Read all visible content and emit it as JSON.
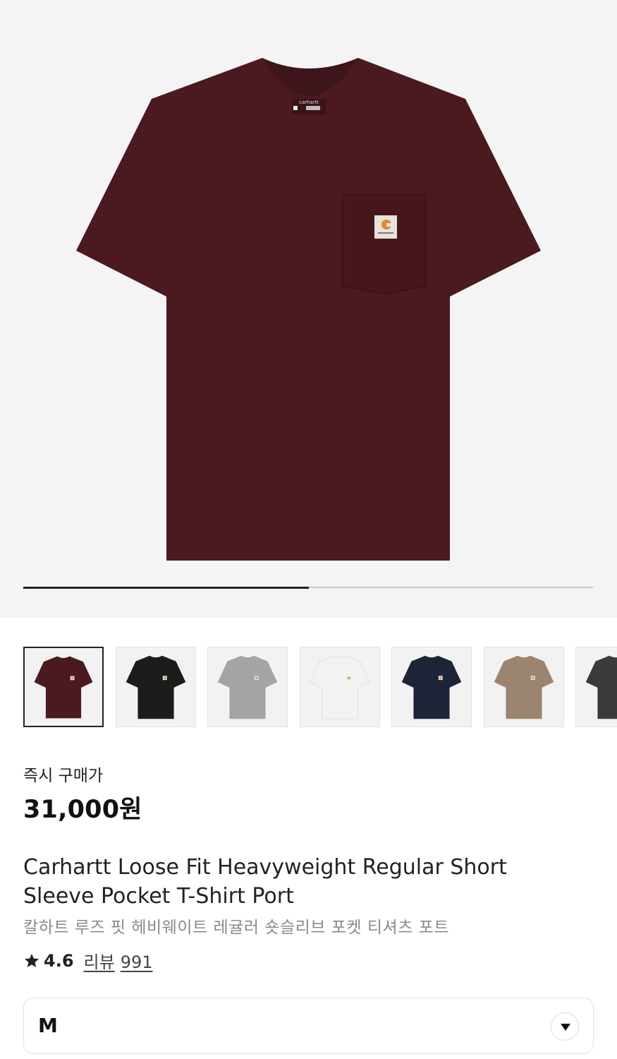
{
  "product": {
    "price_label": "즉시 구매가",
    "price": "31,000원",
    "title": "Carhartt Loose Fit Heavyweight Regular Short Sleeve Pocket T-Shirt Port",
    "subtitle": "칼하트 루즈 핏 헤비웨이트 레귤러 숏슬리브 포켓 티셔츠 포트",
    "rating": "4.6",
    "review_label": "리뷰",
    "review_count": "991",
    "selected_size": "M"
  },
  "gallery": {
    "progress_fraction": 0.5,
    "thumbnails": [
      {
        "color": "#4a1a20",
        "selected": true
      },
      {
        "color": "#1c1c1c",
        "selected": false
      },
      {
        "color": "#a4a4a6",
        "selected": false
      },
      {
        "color": "#f2f2f0",
        "selected": false
      },
      {
        "color": "#1e2437",
        "selected": false
      },
      {
        "color": "#9b8570",
        "selected": false
      },
      {
        "color": "#3a3a3a",
        "selected": false
      }
    ]
  },
  "colors": {
    "shirt_main": "#4a1a20",
    "hero_bg": "#f4f4f4",
    "accent_logo": "#e0892b"
  },
  "icons": {
    "rating": "star-icon",
    "dropdown": "chevron-down-icon"
  }
}
